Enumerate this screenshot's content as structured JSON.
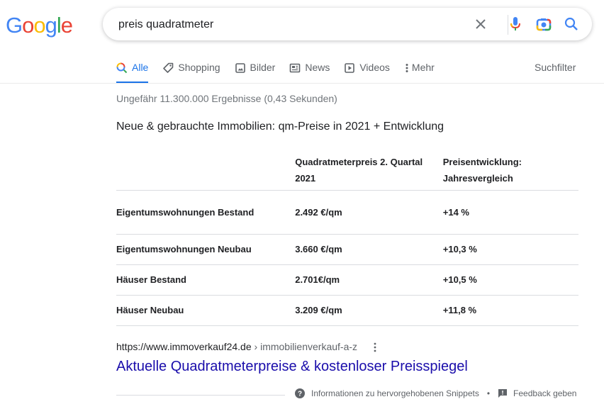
{
  "logo": {
    "letters": [
      "G",
      "o",
      "o",
      "g",
      "l",
      "e"
    ],
    "colors": [
      "#4285f4",
      "#ea4335",
      "#fbbc05",
      "#4285f4",
      "#34a853",
      "#ea4335"
    ]
  },
  "search": {
    "query": "preis quadratmeter",
    "clear_icon": "close-icon",
    "voice_icon": "microphone-icon",
    "lens_icon": "camera-icon",
    "submit_icon": "search-icon"
  },
  "tabs": [
    {
      "label": "Alle",
      "icon": "search-icon",
      "active": true
    },
    {
      "label": "Shopping",
      "icon": "tag-icon",
      "active": false
    },
    {
      "label": "Bilder",
      "icon": "image-icon",
      "active": false
    },
    {
      "label": "News",
      "icon": "newspaper-icon",
      "active": false
    },
    {
      "label": "Videos",
      "icon": "play-icon",
      "active": false
    },
    {
      "label": "Mehr",
      "icon": "more-vert-icon",
      "active": false
    }
  ],
  "search_tools": "Suchfilter",
  "result_stats": "Ungefähr 11.300.000 Ergebnisse (0,43 Sekunden)",
  "featured_snippet": {
    "heading": "Neue & gebrauchte Immobilien: qm-Preise in 2021 + Entwicklung",
    "table": {
      "headers": [
        "",
        "Quadratmeterpreis 2. Quartal 2021",
        "Preisentwicklung: Jahresvergleich"
      ],
      "rows": [
        [
          "Eigentumswohnungen Bestand",
          "2.492 €/qm",
          "+14 %"
        ],
        [
          "Eigentumswohnungen Neubau",
          "3.660 €/qm",
          "+10,3 %"
        ],
        [
          "Häuser Bestand",
          "2.701€/qm",
          "+10,5 %"
        ],
        [
          "Häuser Neubau",
          "3.209 €/qm",
          "+11,8 %"
        ]
      ]
    },
    "source": {
      "domain": "https://www.immoverkauf24.de",
      "path": " › immobilienverkauf-a-z",
      "title": "Aktuelle Quadratmeterpreise & kostenloser Preisspiegel"
    },
    "footer": {
      "about_label": "Informationen zu hervorgehobenen Snippets",
      "separator": "•",
      "feedback_label": "Feedback geben"
    }
  },
  "colors": {
    "link": "#1a0dab",
    "accent": "#1a73e8",
    "secondary_text": "#5f6368"
  }
}
